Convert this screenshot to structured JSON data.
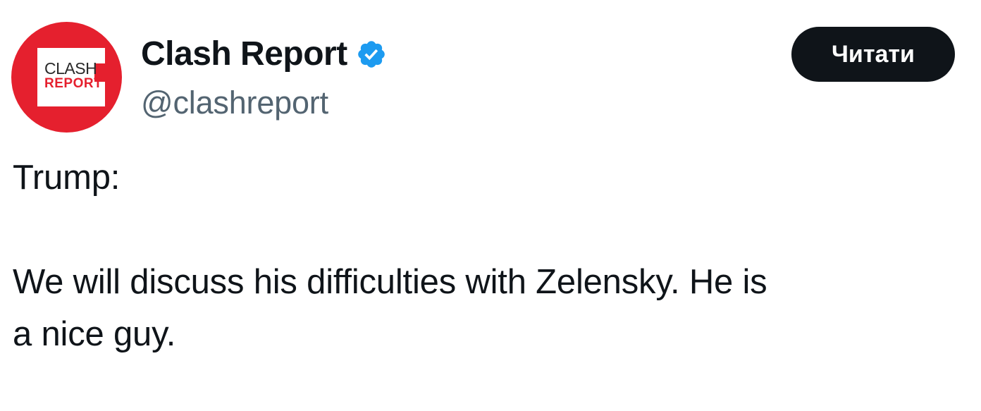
{
  "account": {
    "display_name": "Clash Report",
    "handle": "@clashreport",
    "verified": true,
    "avatar": {
      "logo_line1": "CLASH",
      "logo_line2": "REPORT",
      "brand_color": "#e5202e"
    }
  },
  "follow_button": {
    "label": "Читати"
  },
  "tweet": {
    "lines": [
      "Trump:",
      "",
      "We will discuss his difficulties with Zelensky. He is",
      "a nice guy."
    ]
  },
  "colors": {
    "text": "#0f1419",
    "secondary_text": "#536471",
    "verified_badge": "#1d9bf0",
    "button_bg": "#0f1419",
    "button_text": "#ffffff"
  }
}
